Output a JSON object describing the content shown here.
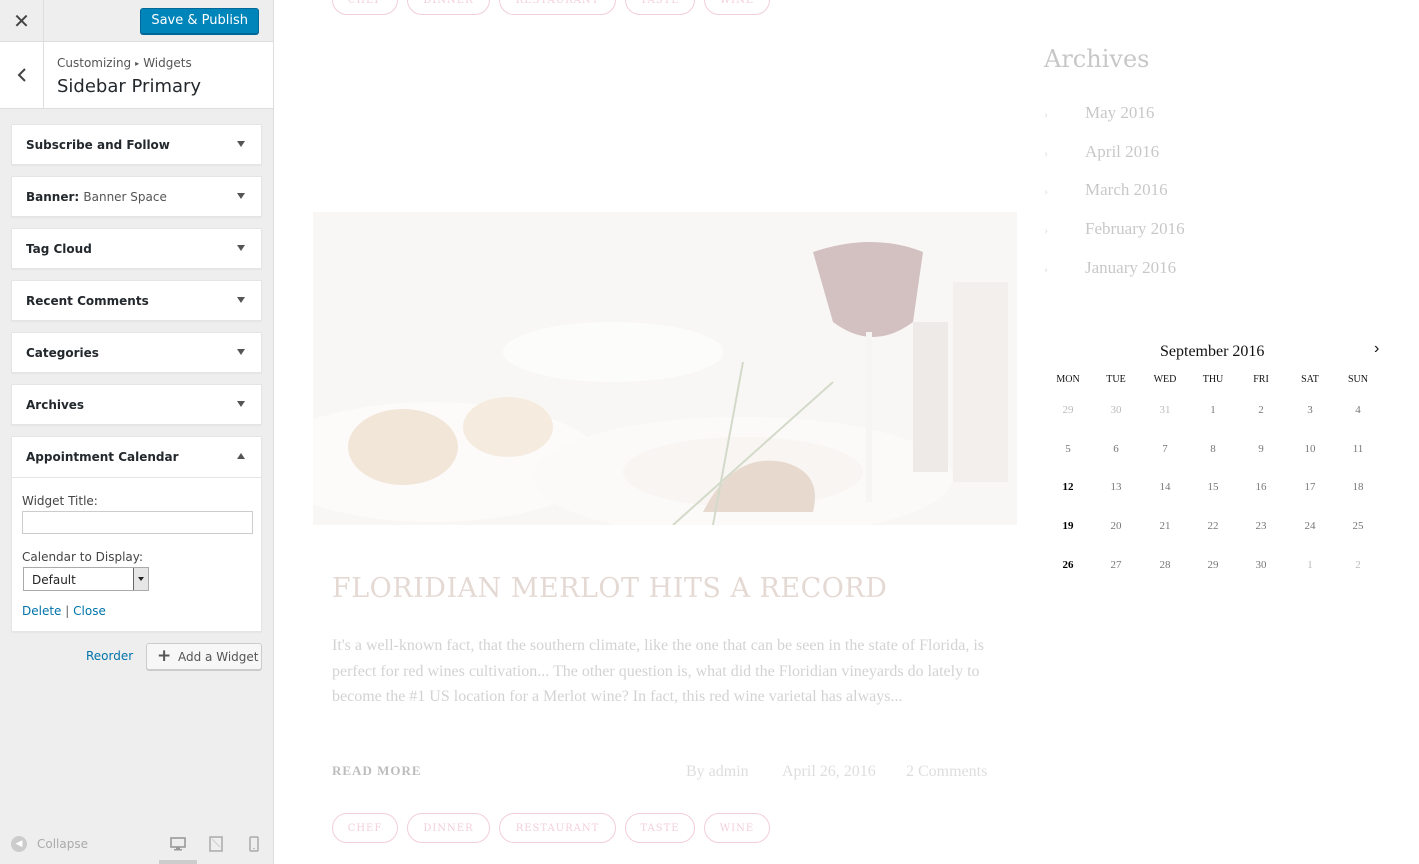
{
  "topbar": {
    "close_icon": "close-icon",
    "publish_label": "Save & Publish"
  },
  "section": {
    "breadcrumb": [
      "Customizing",
      "Widgets"
    ],
    "title": "Sidebar Primary"
  },
  "widgets": [
    {
      "title": "Subscribe and Follow",
      "subtitle": ""
    },
    {
      "title": "Banner:",
      "subtitle": "Banner Space"
    },
    {
      "title": "Tag Cloud",
      "subtitle": ""
    },
    {
      "title": "Recent Comments",
      "subtitle": ""
    },
    {
      "title": "Categories",
      "subtitle": ""
    },
    {
      "title": "Archives",
      "subtitle": ""
    }
  ],
  "appointment_widget": {
    "title": "Appointment Calendar",
    "widget_title_label": "Widget Title:",
    "widget_title_value": "",
    "calendar_label": "Calendar to Display:",
    "calendar_value": "Default",
    "delete_label": "Delete",
    "separator": "|",
    "close_label": "Close"
  },
  "actions": {
    "reorder_label": "Reorder",
    "add_widget_label": "Add a Widget"
  },
  "footer": {
    "collapse_label": "Collapse"
  },
  "preview": {
    "tags": [
      "CHEF",
      "DINNER",
      "RESTAURANT",
      "TASTE",
      "WINE"
    ],
    "post_title": "FLORIDIAN MERLOT HITS A RECORD",
    "post_excerpt": "It's a well-known fact, that the southern climate, like the one that can be seen in the state of Florida, is perfect for red wines cultivation... The other question is, what did the Floridian vineyards do lately to become the #1 US location for a Merlot wine? In fact, this red wine varietal has always...",
    "read_more": "READ MORE",
    "author": "By admin",
    "date": "April 26, 2016",
    "comments": "2 Comments",
    "archives_title": "Archives",
    "archives": [
      "May 2016",
      "April 2016",
      "March 2016",
      "February 2016",
      "January 2016"
    ],
    "calendar": {
      "month": "September 2016",
      "days_of_week": [
        "MON",
        "TUE",
        "WED",
        "THU",
        "FRI",
        "SAT",
        "SUN"
      ],
      "weeks": [
        [
          "29",
          "30",
          "31",
          "1",
          "2",
          "3",
          "4"
        ],
        [
          "5",
          "6",
          "7",
          "8",
          "9",
          "10",
          "11"
        ],
        [
          "12",
          "13",
          "14",
          "15",
          "16",
          "17",
          "18"
        ],
        [
          "19",
          "20",
          "21",
          "22",
          "23",
          "24",
          "25"
        ],
        [
          "26",
          "27",
          "28",
          "29",
          "30",
          "1",
          "2"
        ]
      ],
      "bold_days": [
        "12",
        "19",
        "26"
      ]
    }
  },
  "colors": {
    "accent": "#0085ba",
    "link": "#0073aa",
    "tag": "#d86a8a"
  }
}
